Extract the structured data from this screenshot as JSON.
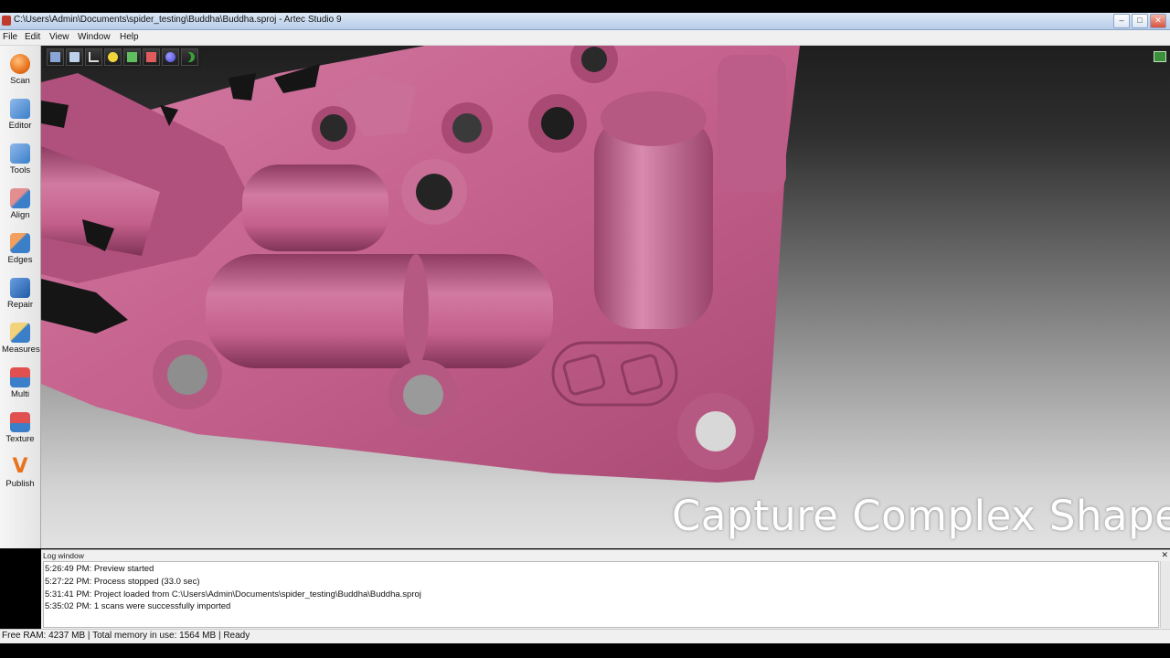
{
  "window": {
    "title": "C:\\Users\\Admin\\Documents\\spider_testing\\Buddha\\Buddha.sproj - Artec Studio 9"
  },
  "menu": [
    "File",
    "Edit",
    "View",
    "Window",
    "Help"
  ],
  "sidebar": [
    {
      "label": "Scan",
      "icon": "scan-icon",
      "color": "#e8731e"
    },
    {
      "label": "Editor",
      "icon": "editor-icon",
      "color": "#3b7fc9"
    },
    {
      "label": "Tools",
      "icon": "tools-icon",
      "color": "#3b7fc9"
    },
    {
      "label": "Align",
      "icon": "align-icon",
      "color": "#c94040"
    },
    {
      "label": "Edges",
      "icon": "edges-icon",
      "color": "#3b7fc9"
    },
    {
      "label": "Repair",
      "icon": "repair-icon",
      "color": "#3b7fc9"
    },
    {
      "label": "Measures",
      "icon": "measures-icon",
      "color": "#c99a30"
    },
    {
      "label": "Multi",
      "icon": "multi-icon",
      "color": "#c93030"
    },
    {
      "label": "Texture",
      "icon": "texture-icon",
      "color": "#c93030"
    },
    {
      "label": "Publish",
      "icon": "publish-icon",
      "color": "#e8731e"
    }
  ],
  "view_toolbar": [
    {
      "icon": "cube-view-icon",
      "color": "#8aa6d6"
    },
    {
      "icon": "fit-view-icon",
      "color": "#bcd0ea"
    },
    {
      "icon": "axes-icon",
      "color": "#d9d9d9"
    },
    {
      "icon": "light-icon",
      "color": "#f0d63a"
    },
    {
      "icon": "solid-render-icon",
      "color": "#5fbf5f"
    },
    {
      "icon": "texture-render-icon",
      "color": "#e05b5b"
    },
    {
      "icon": "sphere-icon",
      "color": "#4a4adf"
    },
    {
      "icon": "crescent-icon",
      "color": "#37a237"
    }
  ],
  "viewport": {
    "caption": "Capture Complex Shapes",
    "model_color": "#c4608c"
  },
  "log": {
    "title": "Log window",
    "lines": [
      "5:26:49 PM: Preview started",
      "5:27:22 PM: Process stopped (33.0 sec)",
      "5:31:41 PM: Project loaded from C:\\Users\\Admin\\Documents\\spider_testing\\Buddha\\Buddha.sproj",
      "5:35:02 PM: 1 scans were successfully imported"
    ]
  },
  "status": "Free RAM: 4237 MB  |  Total memory in use: 1564 MB  |  Ready"
}
